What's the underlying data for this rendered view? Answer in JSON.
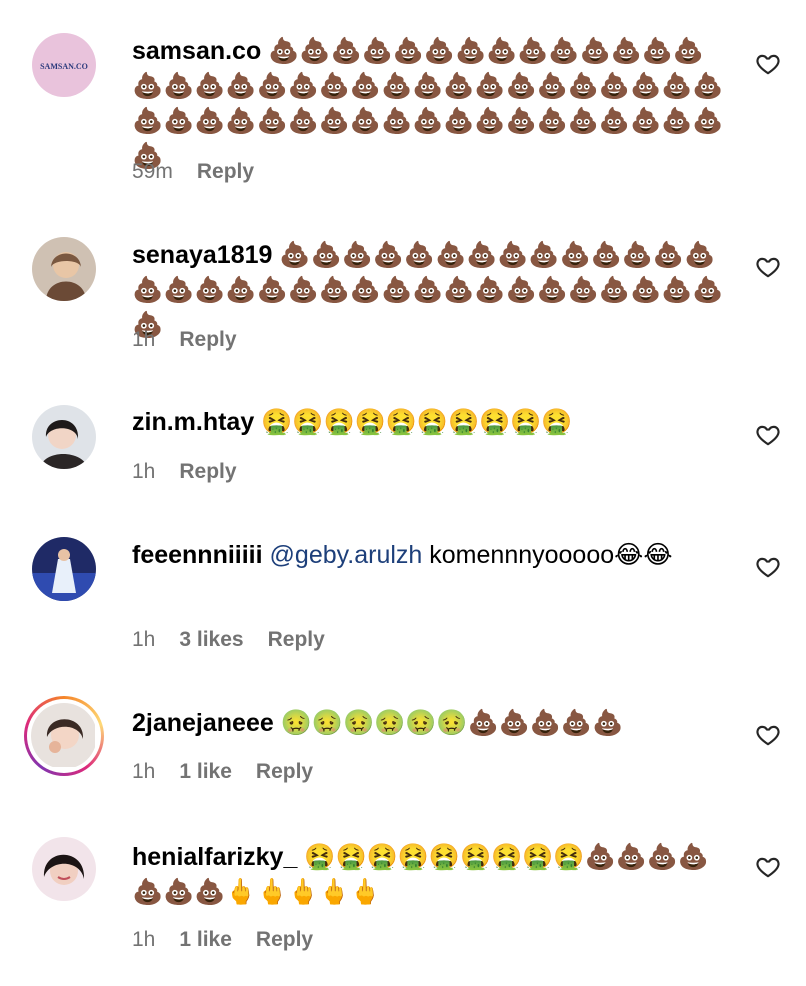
{
  "comments": [
    {
      "username": "samsan.co",
      "avatar_text": "SAMSAN.CO",
      "mention": "",
      "text": "💩💩💩💩💩💩💩💩💩💩💩💩💩💩💩💩💩💩💩💩💩💩💩💩💩💩💩💩💩💩💩💩💩💩💩💩💩💩💩💩💩💩💩💩💩💩💩💩💩💩💩💩💩",
      "time": "59m",
      "likes": "",
      "reply_label": "Reply"
    },
    {
      "username": "senaya1819",
      "mention": "",
      "text": "💩💩💩💩💩💩💩💩💩💩💩💩💩💩💩💩💩💩💩💩💩💩💩💩💩💩💩💩💩💩💩💩💩💩",
      "time": "1h",
      "likes": "",
      "reply_label": "Reply"
    },
    {
      "username": "zin.m.htay",
      "mention": "",
      "text": "🤮🤮🤮🤮🤮🤮🤮🤮🤮🤮",
      "time": "1h",
      "likes": "",
      "reply_label": "Reply"
    },
    {
      "username": "feeennniiiii",
      "mention": "@geby.arulzh",
      "text": "komennnyooooo😂😂",
      "time": "1h",
      "likes": "3 likes",
      "reply_label": "Reply"
    },
    {
      "username": "2janejaneee",
      "mention": "",
      "text": "🤢🤢🤢🤢🤢🤢💩💩💩💩💩",
      "time": "1h",
      "likes": "1 like",
      "reply_label": "Reply"
    },
    {
      "username": "henialfarizky_",
      "mention": "",
      "text": "🤮🤮🤮🤮🤮🤮🤮🤮🤮💩💩💩💩💩💩💩🖕🖕🖕🖕🖕",
      "time": "1h",
      "likes": "1 like",
      "reply_label": "Reply"
    }
  ],
  "icons": {
    "like": "heart-outline-icon"
  },
  "colors": {
    "muted": "#737373",
    "mention": "#1d3f7a"
  }
}
